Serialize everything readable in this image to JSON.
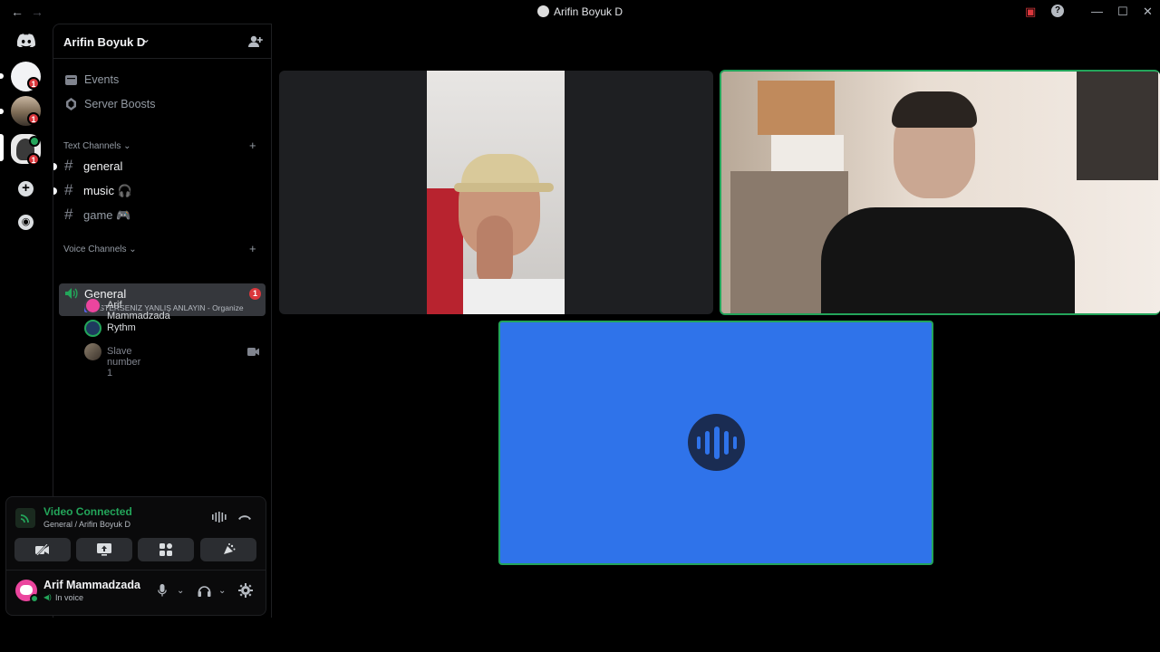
{
  "window": {
    "title": "Arifin Boyuk D",
    "nav_back": "←",
    "nav_forward": "→",
    "controls": {
      "inbox": "▣",
      "help": "?",
      "minimize": "—",
      "maximize": "☐",
      "close": "✕"
    }
  },
  "rail": {
    "badges": [
      "1",
      "1",
      "1"
    ],
    "add_server": "+",
    "discover": "◉"
  },
  "server": {
    "name": "Arifin Boyuk D",
    "chevron": "⌄",
    "invite_icon": "👤+"
  },
  "top_items": [
    {
      "label": "Events",
      "icon": "calendar-icon"
    },
    {
      "label": "Server Boosts",
      "icon": "boost-icon"
    }
  ],
  "text_category": {
    "label": "Text Channels ⌄",
    "plus": "+"
  },
  "text_channels": [
    {
      "name": "general",
      "unread": true
    },
    {
      "name": "music 🎧",
      "unread": true
    },
    {
      "name": "game 🎮",
      "unread": false
    }
  ],
  "voice_category": {
    "label": "Voice Channels ⌄",
    "plus": "+"
  },
  "voice_channel": {
    "name": "General",
    "badge": "1",
    "activity": "İSTERSENİZ YANLIŞ ANLAYIN - Organize"
  },
  "members": [
    {
      "name": "Arif Mammadzada",
      "dim": false
    },
    {
      "name": "Rythm",
      "dim": false
    },
    {
      "name": "Slave number 1",
      "dim": true
    }
  ],
  "connection": {
    "status": "Video Connected",
    "location": "General / Arifin Boyuk D"
  },
  "user": {
    "name": "Arif Mammadzada",
    "status": "In voice"
  },
  "colors": {
    "accent_green": "#23a55a",
    "speaking_blue": "#2f73ea",
    "badge_red": "#da373c",
    "sidebar_bg": "#000000"
  }
}
